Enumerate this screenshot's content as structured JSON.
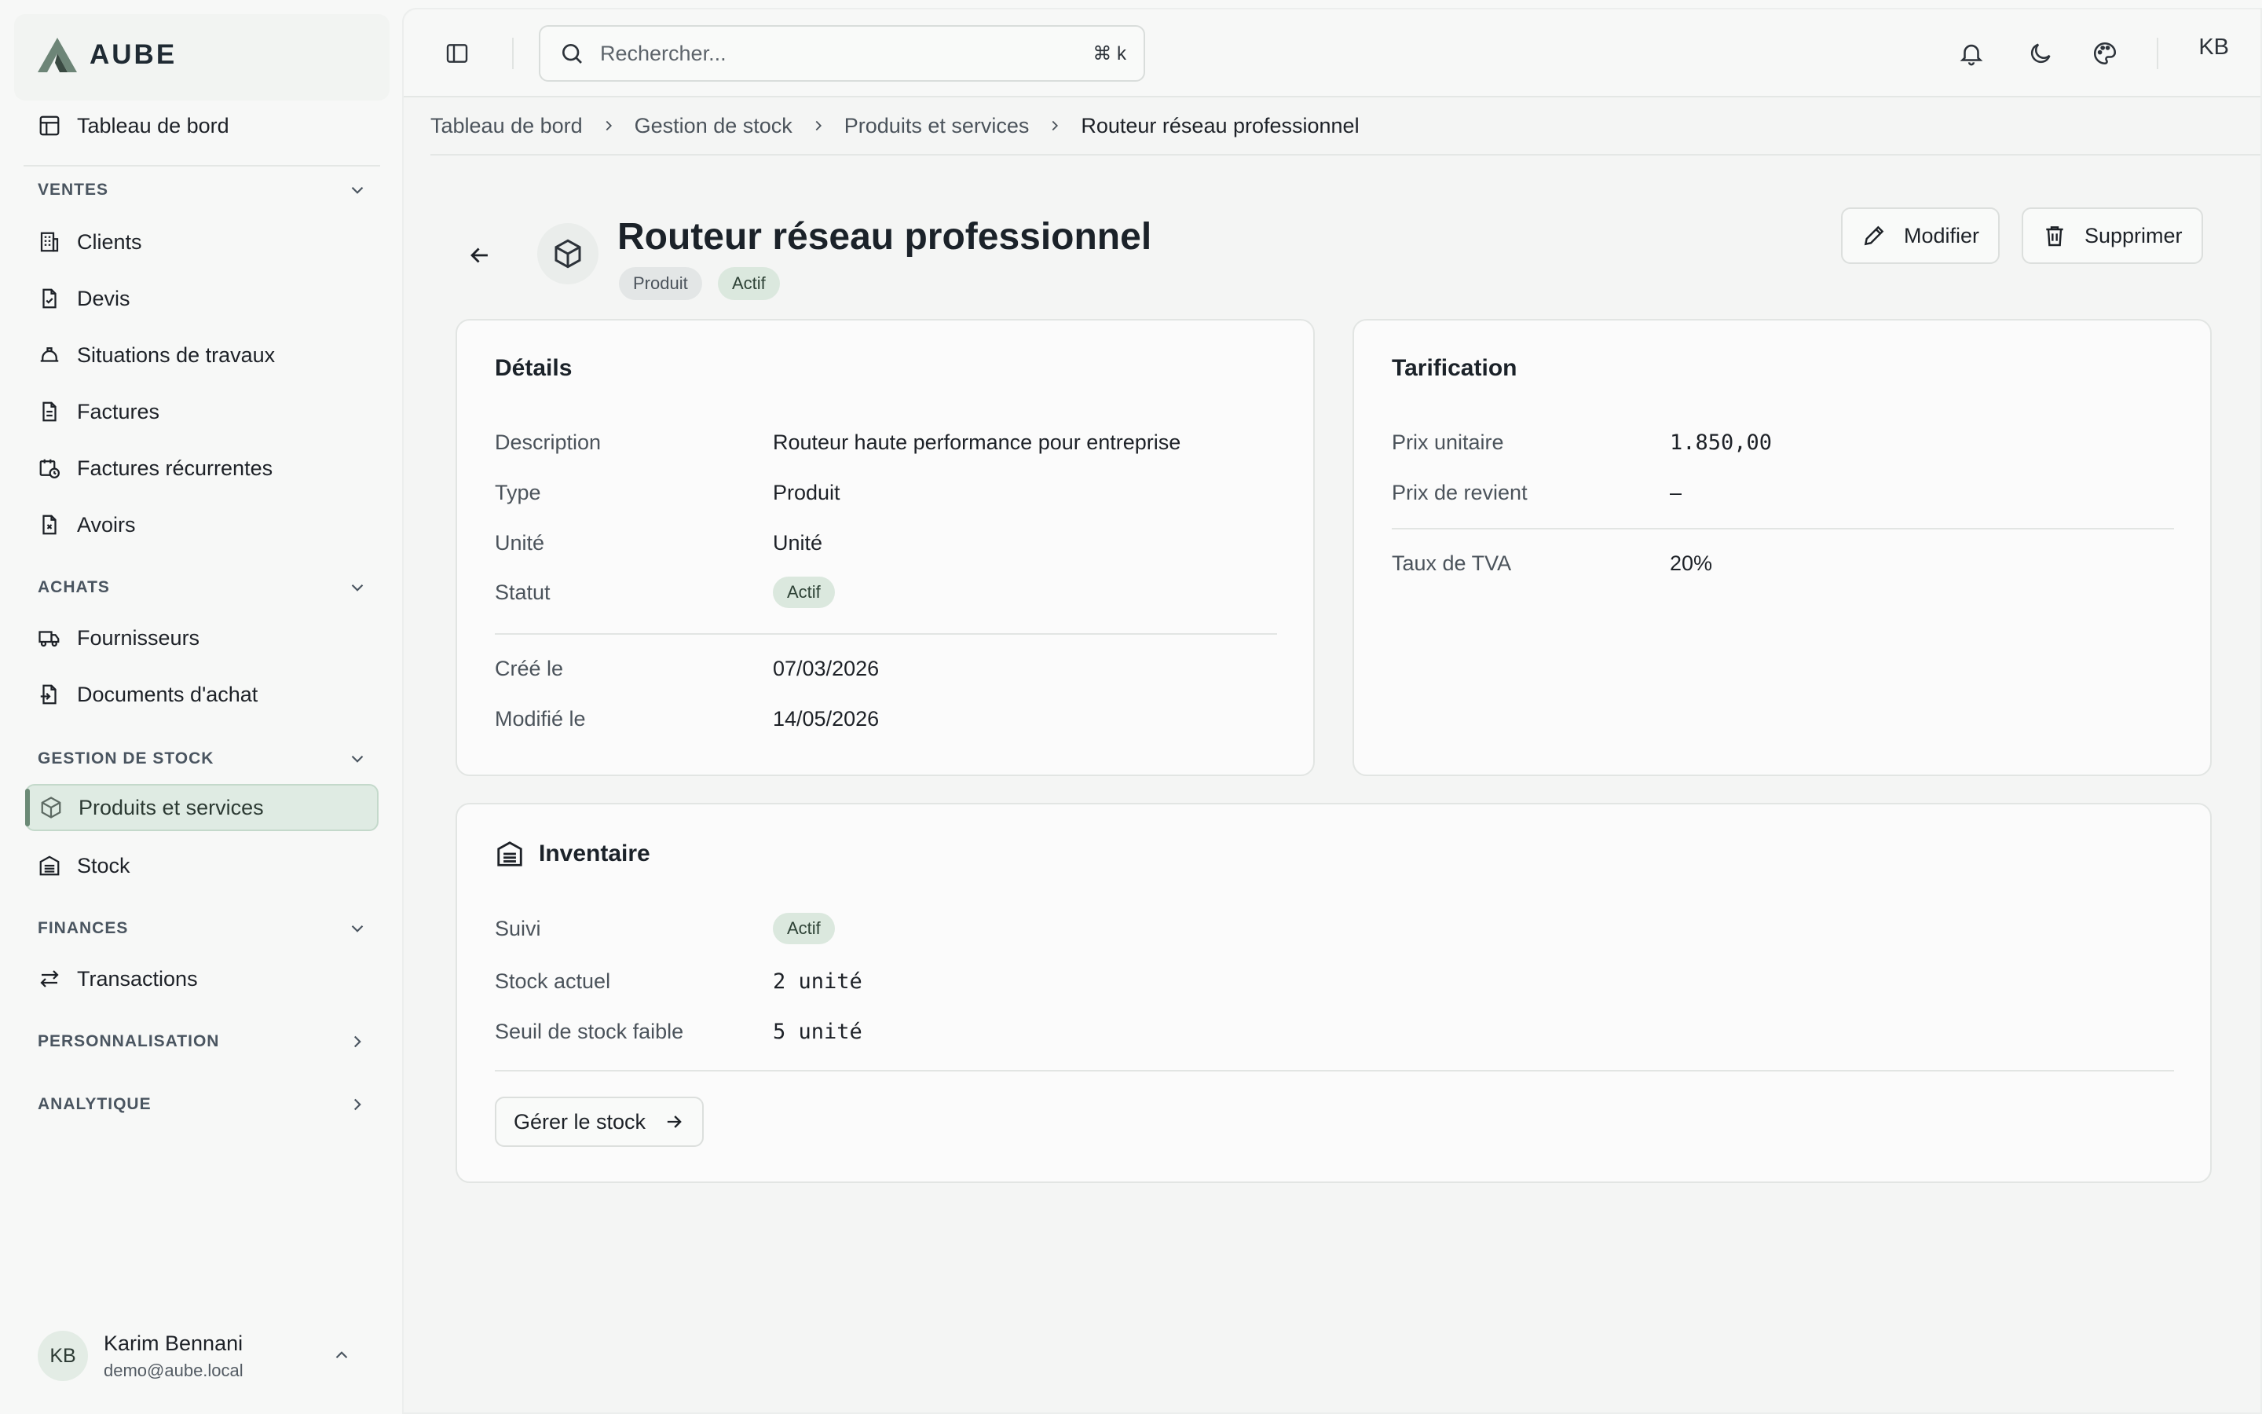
{
  "app": {
    "name": "AUBE"
  },
  "sidebar": {
    "dashboard": "Tableau de bord",
    "sections": [
      {
        "title": "VENTES",
        "expanded": true,
        "items": [
          "Clients",
          "Devis",
          "Situations de travaux",
          "Factures",
          "Factures récurrentes",
          "Avoirs"
        ]
      },
      {
        "title": "ACHATS",
        "expanded": true,
        "items": [
          "Fournisseurs",
          "Documents d'achat"
        ]
      },
      {
        "title": "GESTION DE STOCK",
        "expanded": true,
        "items": [
          "Produits et services",
          "Stock"
        ]
      },
      {
        "title": "FINANCES",
        "expanded": true,
        "items": [
          "Transactions"
        ]
      },
      {
        "title": "PERSONNALISATION",
        "expanded": false,
        "items": []
      },
      {
        "title": "ANALYTIQUE",
        "expanded": false,
        "items": []
      }
    ],
    "active_item": "Produits et services",
    "user": {
      "initials": "KB",
      "name": "Karim Bennani",
      "email": "demo@aube.local"
    }
  },
  "topbar": {
    "search_placeholder": "Rechercher...",
    "search_shortcut": "⌘ k",
    "user_initials": "KB"
  },
  "breadcrumb": [
    "Tableau de bord",
    "Gestion de stock",
    "Produits et services",
    "Routeur réseau professionnel"
  ],
  "product": {
    "title": "Routeur réseau professionnel",
    "badges": [
      "Produit",
      "Actif"
    ],
    "actions": {
      "edit": "Modifier",
      "delete": "Supprimer"
    }
  },
  "details": {
    "title": "Détails",
    "rows": [
      {
        "k": "Description",
        "v": "Routeur haute performance pour entreprise"
      },
      {
        "k": "Type",
        "v": "Produit"
      },
      {
        "k": "Unité",
        "v": "Unité"
      },
      {
        "k": "Statut",
        "v": "Actif"
      }
    ],
    "dates": [
      {
        "k": "Créé le",
        "v": "07/03/2026"
      },
      {
        "k": "Modifié le",
        "v": "14/05/2026"
      }
    ]
  },
  "pricing": {
    "title": "Tarification",
    "rows": [
      {
        "k": "Prix unitaire",
        "v": "1.850,00"
      },
      {
        "k": "Prix de revient",
        "v": "–"
      }
    ],
    "vat": {
      "k": "Taux de TVA",
      "v": "20%"
    }
  },
  "inventory": {
    "title": "Inventaire",
    "rows": [
      {
        "k": "Suivi",
        "v": "Actif"
      },
      {
        "k": "Stock actuel",
        "v": "2 unité"
      },
      {
        "k": "Seuil de stock faible",
        "v": "5 unité"
      }
    ],
    "manage_label": "Gérer le stock"
  },
  "colors": {
    "accent": "#dfebe3",
    "accent_border": "#c4d9cb",
    "badge_green": "#dbe8de"
  }
}
